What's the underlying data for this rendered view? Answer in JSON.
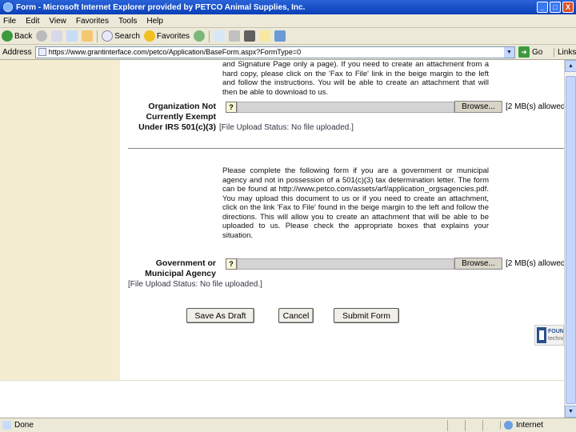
{
  "window": {
    "title": "Form - Microsoft Internet Explorer provided by PETCO Animal Supplies, Inc.",
    "min_glyph": "_",
    "max_glyph": "□",
    "close_glyph": "X"
  },
  "menu": [
    "File",
    "Edit",
    "View",
    "Favorites",
    "Tools",
    "Help"
  ],
  "toolbar": {
    "back": "Back",
    "search": "Search",
    "favorites": "Favorites"
  },
  "address": {
    "label": "Address",
    "url": "https://www.grantinterface.com/petco/Application/BaseForm.aspx?FormType=0",
    "go": "Go",
    "links": "Links"
  },
  "colors": {
    "left_panel": "#f5edd1",
    "title_blue": "#0a3fb8"
  },
  "form": {
    "section1": {
      "text": "and Signature Page only a page). If you need to create an attachment from a hard copy, please click on the 'Fax to File' link in the beige margin to the left and follow the instructions. You will be able to create an attachment that will then be able to download to us.",
      "label": "Organization Not Currently Exempt Under IRS 501(c)(3)",
      "question": "?",
      "browse": "Browse...",
      "max_size": "[2 MB(s) allowed]",
      "status": "[File Upload Status: No file uploaded.]"
    },
    "section2": {
      "text": "Please complete the following form if you are a government or municipal agency and not in possession of a 501(c)(3) tax determination letter. The form can be found at http://www.petco.com/assets/arf/application_orgsagencies.pdf. You may upload this document to us or if you need to create an attachment, click on the link 'Fax to File' found in the beige margin to the left and follow the directions. This will allow you to create an attachment that will be able to be uploaded to us. Please check the appropriate boxes that explains your situation.",
      "label": "Government or Municipal Agency",
      "question": "?",
      "browse": "Browse...",
      "max_size": "[2 MB(s) allowed]",
      "status": "[File Upload Status: No file uploaded.]"
    },
    "buttons": {
      "save_draft": "Save As Draft",
      "cancel": "Cancel",
      "submit": "Submit Form"
    }
  },
  "logo": {
    "line1": "FOUN",
    "line2": "techno"
  },
  "statusbar": {
    "text": "Done",
    "zone": "Internet"
  }
}
